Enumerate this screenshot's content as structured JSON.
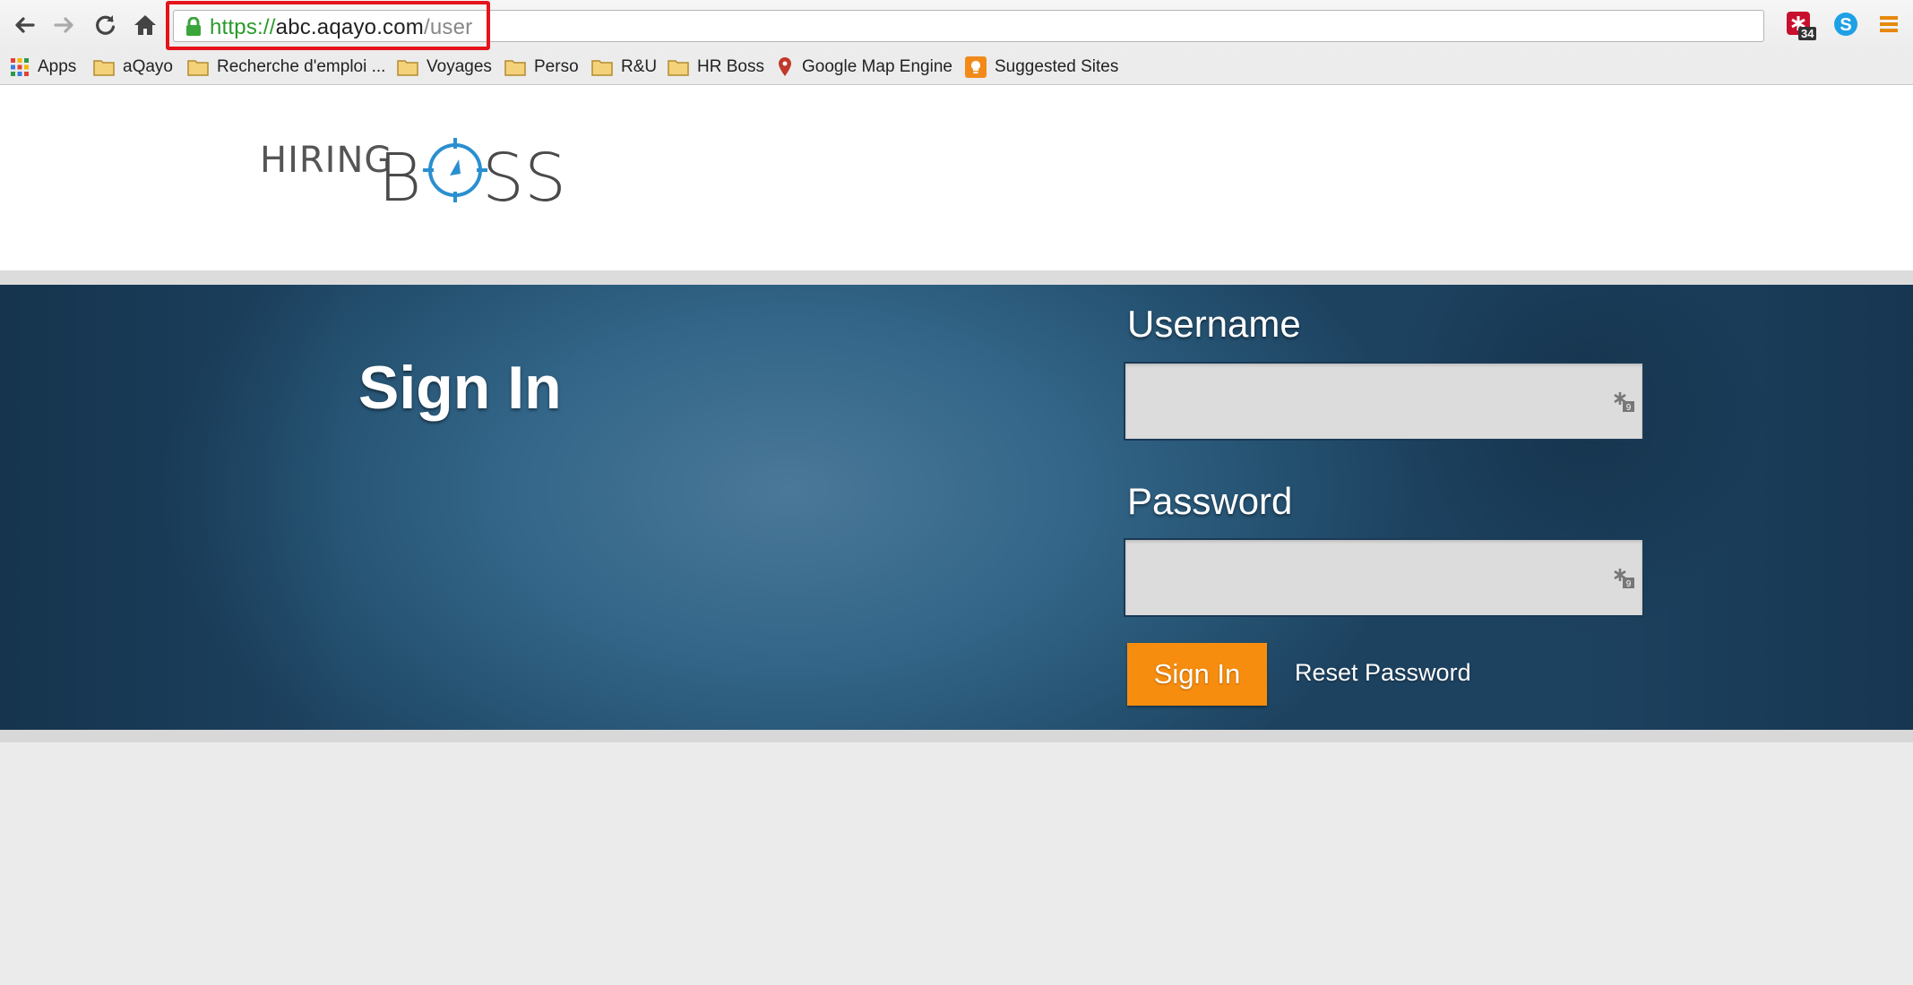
{
  "browser": {
    "url": {
      "scheme": "https://",
      "host": "abc.aqayo.com",
      "path": "/user"
    },
    "extension_badge": "34"
  },
  "bookmarks": [
    {
      "label": "Apps",
      "icon": "apps-grid-icon"
    },
    {
      "label": "aQayo",
      "icon": "folder-icon"
    },
    {
      "label": "Recherche d'emploi ...",
      "icon": "folder-icon"
    },
    {
      "label": "Voyages",
      "icon": "folder-icon"
    },
    {
      "label": "Perso",
      "icon": "folder-icon"
    },
    {
      "label": "R&U",
      "icon": "folder-icon"
    },
    {
      "label": "HR Boss",
      "icon": "folder-icon"
    },
    {
      "label": "Google Map Engine",
      "icon": "map-pin-icon"
    },
    {
      "label": "Suggested Sites",
      "icon": "lightbulb-icon"
    }
  ],
  "logo": {
    "part1": "HIRING",
    "part2a": "B",
    "part2b": "SS"
  },
  "signin": {
    "title": "Sign In",
    "username_label": "Username",
    "username_value": "",
    "password_label": "Password",
    "password_value": "",
    "submit_label": "Sign In",
    "reset_label": "Reset Password"
  },
  "colors": {
    "accent_orange": "#f78d0e",
    "hero_blue": "#336689",
    "logo_blue": "#2a8fd0",
    "url_highlight_red": "#e5141c"
  }
}
